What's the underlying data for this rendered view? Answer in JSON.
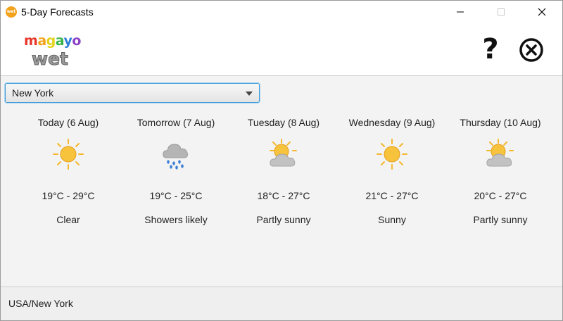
{
  "window": {
    "title": "5-Day Forecasts",
    "app_icon_text": "wet"
  },
  "logo": {
    "line1": "magayo",
    "line2": "wet"
  },
  "toolbar": {
    "help_label": "?"
  },
  "city_select": {
    "value": "New York"
  },
  "forecasts": [
    {
      "day": "Today (6 Aug)",
      "icon": "sunny-icon",
      "temp": "19°C - 29°C",
      "condition": "Clear"
    },
    {
      "day": "Tomorrow (7 Aug)",
      "icon": "rain-cloud-icon",
      "temp": "19°C - 25°C",
      "condition": "Showers likely"
    },
    {
      "day": "Tuesday (8 Aug)",
      "icon": "partly-sunny-icon",
      "temp": "18°C - 27°C",
      "condition": "Partly sunny"
    },
    {
      "day": "Wednesday (9 Aug)",
      "icon": "sunny-icon",
      "temp": "21°C - 27°C",
      "condition": "Sunny"
    },
    {
      "day": "Thursday (10 Aug)",
      "icon": "partly-sunny-icon",
      "temp": "20°C - 27°C",
      "condition": "Partly sunny"
    }
  ],
  "status": {
    "location": "USA/New York"
  },
  "colors": {
    "sun": "#f5b82e",
    "cloud": "#b9b9b9",
    "rain": "#3b7fd6",
    "select_border": "#3c9ad8"
  }
}
